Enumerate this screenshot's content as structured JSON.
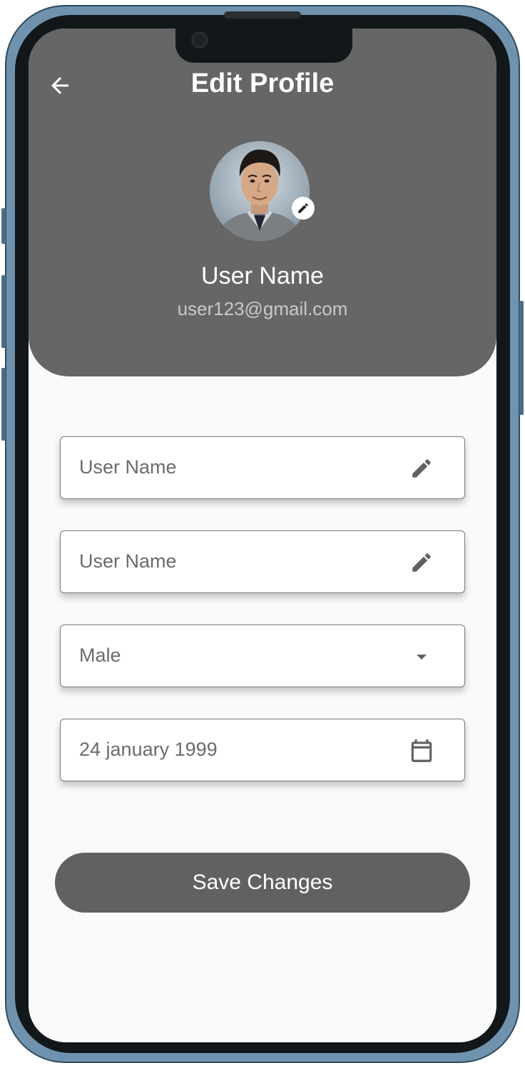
{
  "header": {
    "title": "Edit Profile",
    "back_icon": "arrow-left-icon"
  },
  "profile": {
    "name": "User Name",
    "email": "user123@gmail.com",
    "avatar_edit_icon": "pencil-icon"
  },
  "form": {
    "fields": [
      {
        "value": "User Name",
        "icon": "pencil-icon"
      },
      {
        "value": "User Name",
        "icon": "pencil-icon"
      },
      {
        "value": "Male",
        "icon": "dropdown-arrow-icon"
      },
      {
        "value": "24 january 1999",
        "icon": "calendar-icon"
      }
    ]
  },
  "actions": {
    "save_label": "Save Changes"
  },
  "colors": {
    "header_bg": "#666666",
    "button_bg": "#616161",
    "frame": "#6f93ae"
  }
}
